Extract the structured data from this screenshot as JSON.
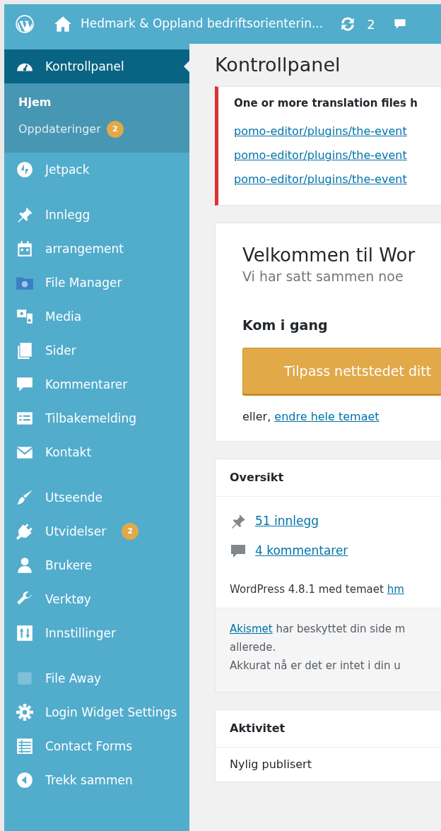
{
  "admin_bar": {
    "site_title": "Hedmark & Oppland bedriftsorienterin...",
    "updates_count": "2"
  },
  "sidebar": {
    "groups": [
      [
        {
          "label": "Kontrollpanel",
          "selected": true,
          "children": [
            {
              "label": "Hjem",
              "selected": true
            },
            {
              "label": "Oppdateringer",
              "selected": false,
              "badge": "2"
            }
          ]
        },
        {
          "label": "Jetpack",
          "selected": false
        }
      ],
      [
        {
          "label": "Innlegg",
          "selected": false
        },
        {
          "label": "arrangement",
          "selected": false
        },
        {
          "label": "File Manager",
          "selected": false
        },
        {
          "label": "Media",
          "selected": false
        },
        {
          "label": "Sider",
          "selected": false
        },
        {
          "label": "Kommentarer",
          "selected": false
        },
        {
          "label": "Tilbakemelding",
          "selected": false
        },
        {
          "label": "Kontakt",
          "selected": false
        }
      ],
      [
        {
          "label": "Utseende",
          "selected": false
        },
        {
          "label": "Utvidelser",
          "selected": false,
          "badge": "2"
        },
        {
          "label": "Brukere",
          "selected": false
        },
        {
          "label": "Verktøy",
          "selected": false
        },
        {
          "label": "Innstillinger",
          "selected": false
        }
      ],
      [
        {
          "label": "File Away",
          "selected": false
        },
        {
          "label": "Login Widget Settings",
          "selected": false
        },
        {
          "label": "Contact Forms",
          "selected": false
        },
        {
          "label": "Trekk sammen",
          "selected": false
        }
      ]
    ]
  },
  "page_title": "Kontrollpanel",
  "notice": {
    "message": "One or more translation files h",
    "links": [
      "pomo-editor/plugins/the-event",
      "pomo-editor/plugins/the-event",
      "pomo-editor/plugins/the-event"
    ]
  },
  "welcome": {
    "title": "Velkommen til Wor",
    "subtitle": "Vi har satt sammen noe",
    "heading": "Kom i gang",
    "button": "Tilpass nettstedet ditt",
    "alt_prefix": "eller,",
    "alt_link": "endre hele temaet"
  },
  "overview": {
    "title": "Oversikt",
    "items": [
      "51 innlegg",
      "4 kommentarer"
    ],
    "version_text": "WordPress 4.8.1 med temaet",
    "theme_link": "hm",
    "akismet_link": "Akismet",
    "akismet_text": "har beskyttet din side m",
    "akismet_continued": "allerede.",
    "queue_text": "Akkurat nå er det er intet i din u"
  },
  "activity": {
    "title": "Aktivitet",
    "section": "Nylig publisert"
  }
}
